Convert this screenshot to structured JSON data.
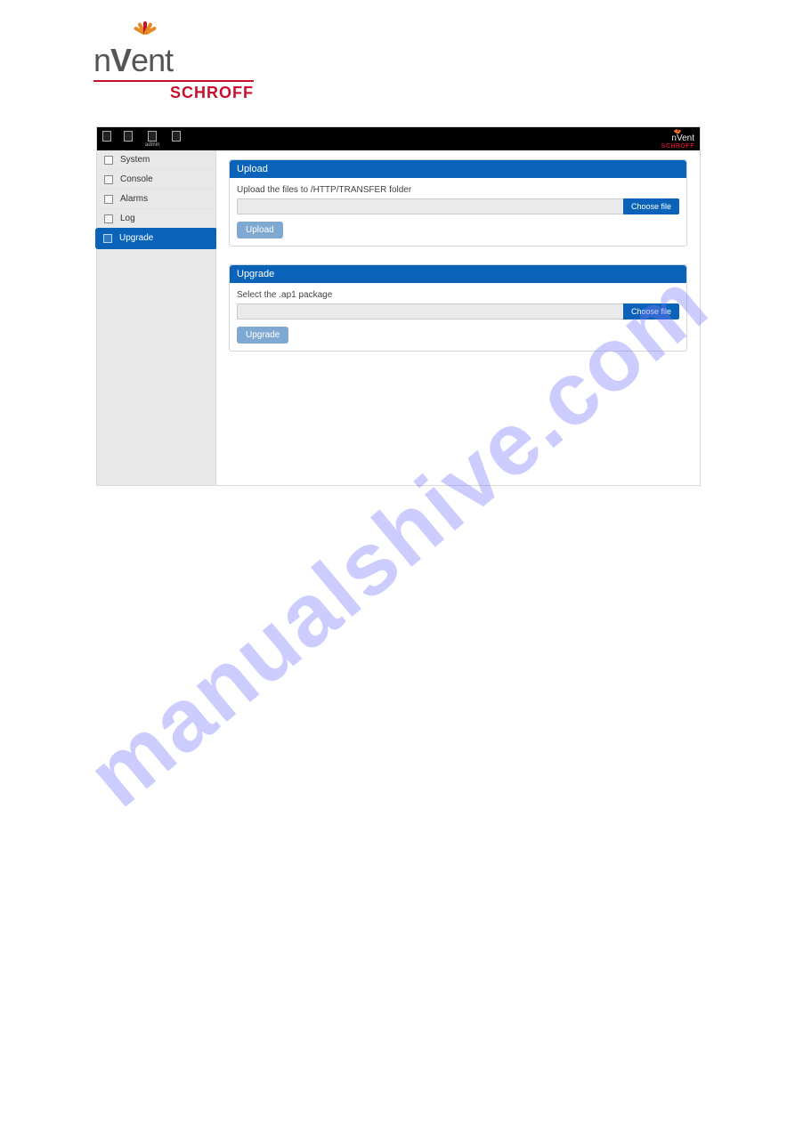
{
  "watermark": "manualshive.com",
  "brand": {
    "name": "nVent",
    "sub": "SCHROFF"
  },
  "topbar": {
    "items": [
      {
        "label": ""
      },
      {
        "label": ""
      },
      {
        "label": "admin"
      },
      {
        "label": ""
      }
    ]
  },
  "sidebar": {
    "items": [
      {
        "label": "System",
        "active": false
      },
      {
        "label": "Console",
        "active": false
      },
      {
        "label": "Alarms",
        "active": false
      },
      {
        "label": "Log",
        "active": false
      },
      {
        "label": "Upgrade",
        "active": true
      }
    ]
  },
  "upload_panel": {
    "title": "Upload",
    "hint": "Upload the files to /HTTP/TRANSFER folder",
    "choose_label": "Choose file",
    "action_label": "Upload"
  },
  "upgrade_panel": {
    "title": "Upgrade",
    "hint": "Select the .ap1 package",
    "choose_label": "Choose file",
    "action_label": "Upgrade"
  }
}
